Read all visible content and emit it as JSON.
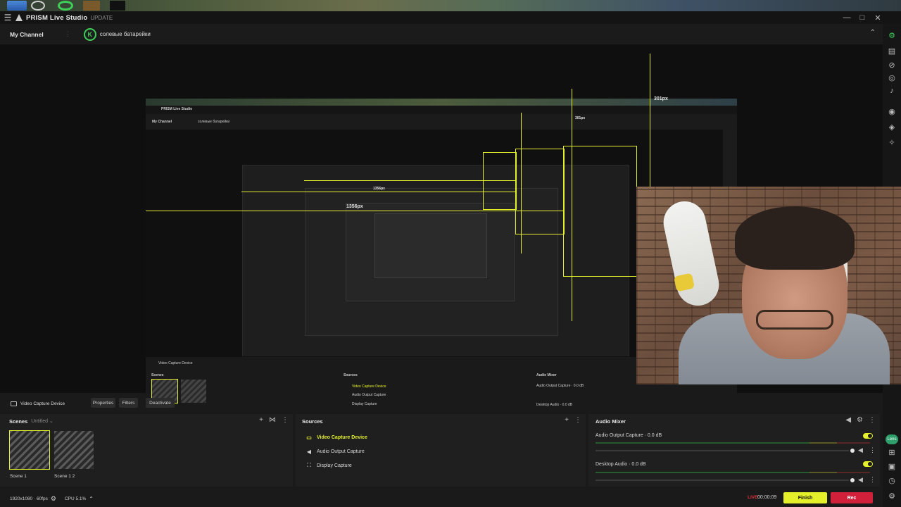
{
  "app": {
    "name": "PRISM Live Studio",
    "update_label": "UPDATE"
  },
  "channel": {
    "label": "My Channel",
    "title": "солевые батарейки",
    "badge_letter": "K"
  },
  "preview": {
    "dim_width_label": "1356px",
    "dim_height_label": "301px",
    "nested_dim_label": "1356px",
    "nested_dim_height_label": "301px"
  },
  "source_toolbar": {
    "source_name": "Video Capture Device",
    "buttons": [
      "Properties",
      "Filters",
      "Deactivate"
    ]
  },
  "scenes": {
    "title": "Scenes",
    "collection": "Untitled",
    "items": [
      {
        "label": "Scene 1",
        "selected": true
      },
      {
        "label": "Scene 1 2",
        "selected": false
      }
    ]
  },
  "sources": {
    "title": "Sources",
    "items": [
      {
        "label": "Video Capture Device",
        "icon": "monitor-icon",
        "active": true
      },
      {
        "label": "Audio Output Capture",
        "icon": "speaker-icon",
        "active": false
      },
      {
        "label": "Display Capture",
        "icon": "display-capture-icon",
        "active": false
      }
    ]
  },
  "audio_mixer": {
    "title": "Audio Mixer",
    "channels": [
      {
        "label": "Audio Output Capture · 0.0 dB",
        "enabled": true
      },
      {
        "label": "Desktop Audio · 0.0 dB",
        "enabled": true
      }
    ]
  },
  "status": {
    "resolution": "1920x1080 · 60fps",
    "cpu": "CPU 5.1%",
    "live_label": "LIVE",
    "live_time": "00:00:09",
    "finish_label": "Finish",
    "rec_label": "Rec"
  },
  "colors": {
    "accent": "#e4f02a",
    "rec": "#d0203a",
    "live": "#e0303a",
    "channel_green": "#3ecf5a"
  }
}
